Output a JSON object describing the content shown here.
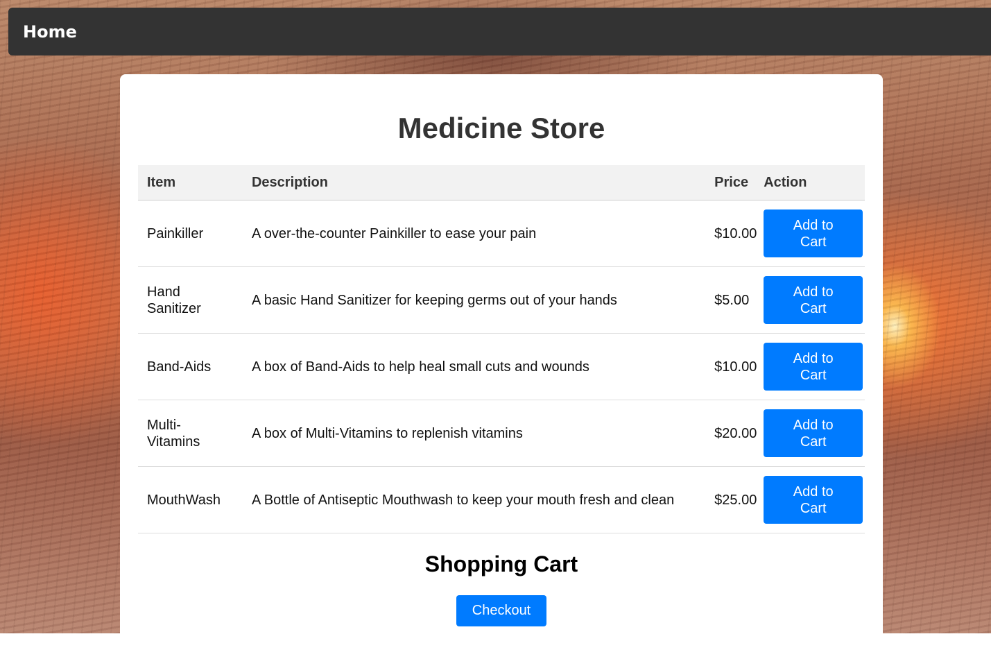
{
  "nav": {
    "home_label": "Home"
  },
  "store": {
    "title": "Medicine Store"
  },
  "table": {
    "headers": {
      "item": "Item",
      "description": "Description",
      "price": "Price",
      "action": "Action"
    },
    "rows": [
      {
        "item": "Painkiller",
        "description": "A over-the-counter Painkiller to ease your pain",
        "price": "$10.00",
        "button": "Add to Cart"
      },
      {
        "item": "Hand Sanitizer",
        "description": "A basic Hand Sanitizer for keeping germs out of your hands",
        "price": "$5.00",
        "button": "Add to Cart"
      },
      {
        "item": "Band-Aids",
        "description": "A box of Band-Aids to help heal small cuts and wounds",
        "price": "$10.00",
        "button": "Add to Cart"
      },
      {
        "item": "Multi-Vitamins",
        "description": "A box of Multi-Vitamins to replenish vitamins",
        "price": "$20.00",
        "button": "Add to Cart"
      },
      {
        "item": "MouthWash",
        "description": "A Bottle of Antiseptic Mouthwash to keep your mouth fresh and clean",
        "price": "$25.00",
        "button": "Add to Cart"
      }
    ]
  },
  "cart": {
    "title": "Shopping Cart",
    "checkout_label": "Checkout"
  },
  "colors": {
    "nav_background": "#333333",
    "primary_button": "#007bff",
    "header_row": "#f2f2f2"
  }
}
